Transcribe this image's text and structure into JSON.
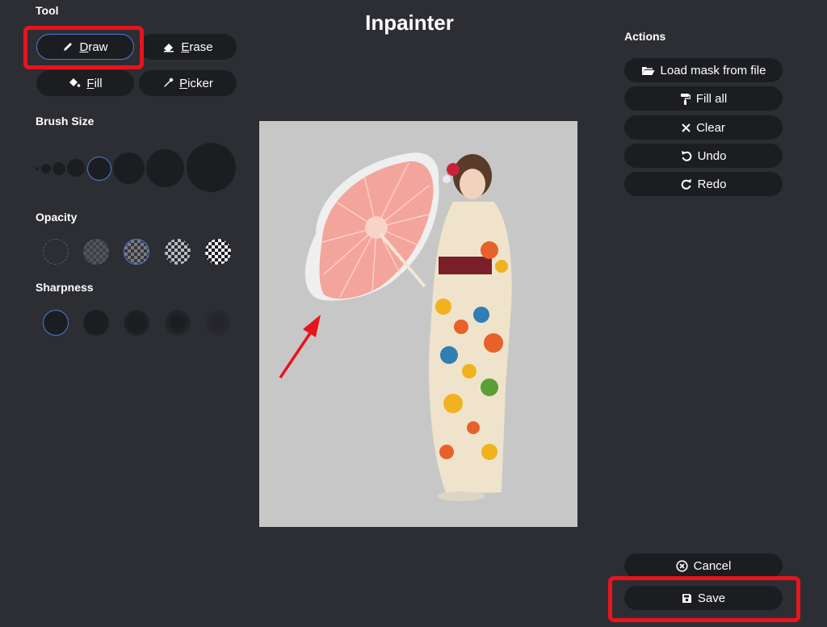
{
  "title": "Inpainter",
  "tool": {
    "label": "Tool",
    "buttons": [
      {
        "label": "Draw",
        "icon": "pencil-icon",
        "active": true
      },
      {
        "label": "Erase",
        "icon": "eraser-icon"
      },
      {
        "label": "Fill",
        "icon": "paint-bucket-icon"
      },
      {
        "label": "Picker",
        "icon": "eyedropper-icon"
      }
    ]
  },
  "brush_size": {
    "label": "Brush Size",
    "option_count": 8,
    "selected_index": 4
  },
  "opacity": {
    "label": "Opacity",
    "option_count": 5,
    "selected_index": 2
  },
  "sharpness": {
    "label": "Sharpness",
    "option_count": 5,
    "selected_index": 0
  },
  "actions": {
    "label": "Actions",
    "buttons": [
      {
        "label": "Load mask from file",
        "icon": "folder-open-icon"
      },
      {
        "label": "Fill all",
        "icon": "paint-roller-icon"
      },
      {
        "label": "Clear",
        "icon": "close-icon"
      },
      {
        "label": "Undo",
        "icon": "undo-icon"
      },
      {
        "label": "Redo",
        "icon": "redo-icon"
      }
    ]
  },
  "footer": {
    "cancel_label": "Cancel",
    "save_label": "Save"
  },
  "colors": {
    "background": "#2d2e33",
    "button": "#1c1d21",
    "accent": "#4a7bd6",
    "annotation": "#e8141c",
    "canvas": "#c7c7c7",
    "mask": "#ffb2a8"
  }
}
